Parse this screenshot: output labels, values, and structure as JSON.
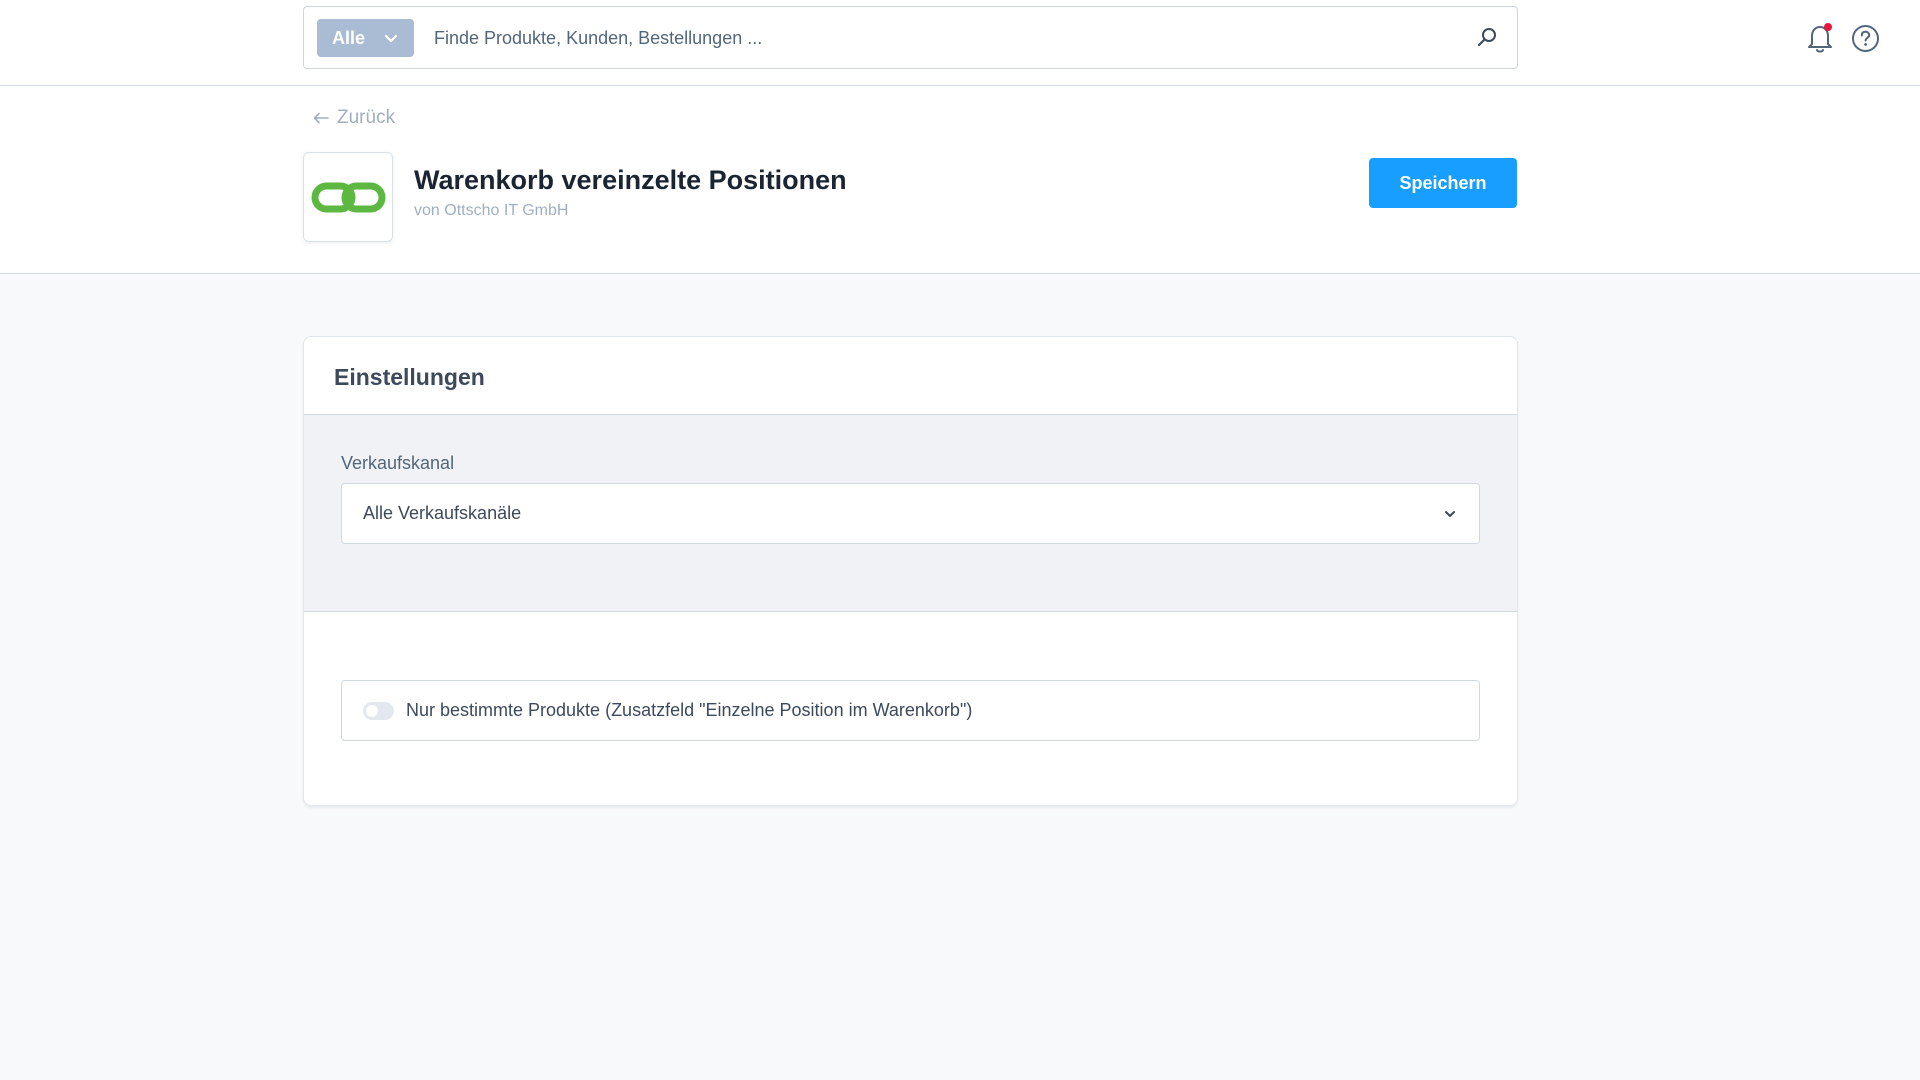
{
  "search": {
    "type_label": "Alle",
    "placeholder": "Finde Produkte, Kunden, Bestellungen ..."
  },
  "header": {
    "back_label": "Zurück",
    "app_title": "Warenkorb vereinzelte Positionen",
    "app_vendor": "von Ottscho IT GmbH",
    "save_label": "Speichern"
  },
  "settings": {
    "card_title": "Einstellungen",
    "sales_channel_label": "Verkaufskanal",
    "sales_channel_value": "Alle Verkaufskanäle",
    "toggle_label": "Nur bestimmte Produkte (Zusatzfeld \"Einzelne Position im Warenkorb\")",
    "toggle_on": false
  },
  "icons": {
    "search": "search-icon",
    "bell": "bell-icon",
    "help": "help-icon",
    "back": "arrow-left-icon",
    "logo": "chain-link-logo"
  },
  "colors": {
    "primary": "#189eff",
    "search_type_bg": "#a9bcd3",
    "logo_green": "#5cb841",
    "notification_dot": "#e3173d"
  }
}
